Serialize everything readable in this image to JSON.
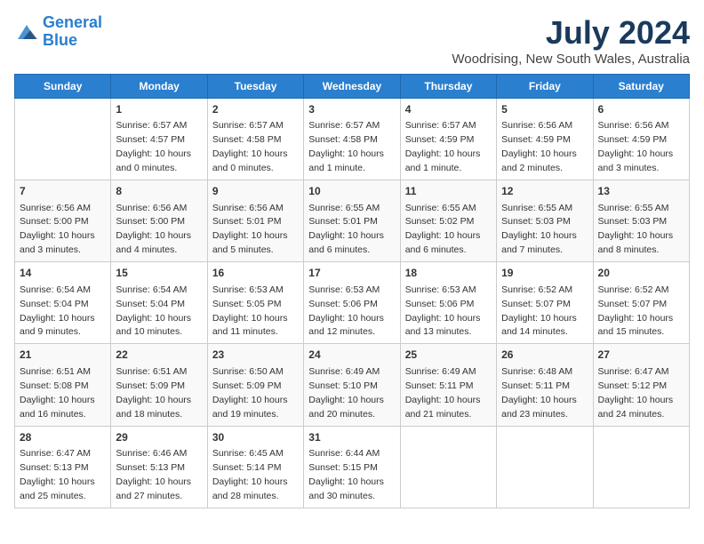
{
  "logo": {
    "line1": "General",
    "line2": "Blue"
  },
  "title": "July 2024",
  "location": "Woodrising, New South Wales, Australia",
  "days_header": [
    "Sunday",
    "Monday",
    "Tuesday",
    "Wednesday",
    "Thursday",
    "Friday",
    "Saturday"
  ],
  "weeks": [
    [
      {
        "num": "",
        "sunrise": "",
        "sunset": "",
        "daylight": ""
      },
      {
        "num": "1",
        "sunrise": "Sunrise: 6:57 AM",
        "sunset": "Sunset: 4:57 PM",
        "daylight": "Daylight: 10 hours and 0 minutes."
      },
      {
        "num": "2",
        "sunrise": "Sunrise: 6:57 AM",
        "sunset": "Sunset: 4:58 PM",
        "daylight": "Daylight: 10 hours and 0 minutes."
      },
      {
        "num": "3",
        "sunrise": "Sunrise: 6:57 AM",
        "sunset": "Sunset: 4:58 PM",
        "daylight": "Daylight: 10 hours and 1 minute."
      },
      {
        "num": "4",
        "sunrise": "Sunrise: 6:57 AM",
        "sunset": "Sunset: 4:59 PM",
        "daylight": "Daylight: 10 hours and 1 minute."
      },
      {
        "num": "5",
        "sunrise": "Sunrise: 6:56 AM",
        "sunset": "Sunset: 4:59 PM",
        "daylight": "Daylight: 10 hours and 2 minutes."
      },
      {
        "num": "6",
        "sunrise": "Sunrise: 6:56 AM",
        "sunset": "Sunset: 4:59 PM",
        "daylight": "Daylight: 10 hours and 3 minutes."
      }
    ],
    [
      {
        "num": "7",
        "sunrise": "Sunrise: 6:56 AM",
        "sunset": "Sunset: 5:00 PM",
        "daylight": "Daylight: 10 hours and 3 minutes."
      },
      {
        "num": "8",
        "sunrise": "Sunrise: 6:56 AM",
        "sunset": "Sunset: 5:00 PM",
        "daylight": "Daylight: 10 hours and 4 minutes."
      },
      {
        "num": "9",
        "sunrise": "Sunrise: 6:56 AM",
        "sunset": "Sunset: 5:01 PM",
        "daylight": "Daylight: 10 hours and 5 minutes."
      },
      {
        "num": "10",
        "sunrise": "Sunrise: 6:55 AM",
        "sunset": "Sunset: 5:01 PM",
        "daylight": "Daylight: 10 hours and 6 minutes."
      },
      {
        "num": "11",
        "sunrise": "Sunrise: 6:55 AM",
        "sunset": "Sunset: 5:02 PM",
        "daylight": "Daylight: 10 hours and 6 minutes."
      },
      {
        "num": "12",
        "sunrise": "Sunrise: 6:55 AM",
        "sunset": "Sunset: 5:03 PM",
        "daylight": "Daylight: 10 hours and 7 minutes."
      },
      {
        "num": "13",
        "sunrise": "Sunrise: 6:55 AM",
        "sunset": "Sunset: 5:03 PM",
        "daylight": "Daylight: 10 hours and 8 minutes."
      }
    ],
    [
      {
        "num": "14",
        "sunrise": "Sunrise: 6:54 AM",
        "sunset": "Sunset: 5:04 PM",
        "daylight": "Daylight: 10 hours and 9 minutes."
      },
      {
        "num": "15",
        "sunrise": "Sunrise: 6:54 AM",
        "sunset": "Sunset: 5:04 PM",
        "daylight": "Daylight: 10 hours and 10 minutes."
      },
      {
        "num": "16",
        "sunrise": "Sunrise: 6:53 AM",
        "sunset": "Sunset: 5:05 PM",
        "daylight": "Daylight: 10 hours and 11 minutes."
      },
      {
        "num": "17",
        "sunrise": "Sunrise: 6:53 AM",
        "sunset": "Sunset: 5:06 PM",
        "daylight": "Daylight: 10 hours and 12 minutes."
      },
      {
        "num": "18",
        "sunrise": "Sunrise: 6:53 AM",
        "sunset": "Sunset: 5:06 PM",
        "daylight": "Daylight: 10 hours and 13 minutes."
      },
      {
        "num": "19",
        "sunrise": "Sunrise: 6:52 AM",
        "sunset": "Sunset: 5:07 PM",
        "daylight": "Daylight: 10 hours and 14 minutes."
      },
      {
        "num": "20",
        "sunrise": "Sunrise: 6:52 AM",
        "sunset": "Sunset: 5:07 PM",
        "daylight": "Daylight: 10 hours and 15 minutes."
      }
    ],
    [
      {
        "num": "21",
        "sunrise": "Sunrise: 6:51 AM",
        "sunset": "Sunset: 5:08 PM",
        "daylight": "Daylight: 10 hours and 16 minutes."
      },
      {
        "num": "22",
        "sunrise": "Sunrise: 6:51 AM",
        "sunset": "Sunset: 5:09 PM",
        "daylight": "Daylight: 10 hours and 18 minutes."
      },
      {
        "num": "23",
        "sunrise": "Sunrise: 6:50 AM",
        "sunset": "Sunset: 5:09 PM",
        "daylight": "Daylight: 10 hours and 19 minutes."
      },
      {
        "num": "24",
        "sunrise": "Sunrise: 6:49 AM",
        "sunset": "Sunset: 5:10 PM",
        "daylight": "Daylight: 10 hours and 20 minutes."
      },
      {
        "num": "25",
        "sunrise": "Sunrise: 6:49 AM",
        "sunset": "Sunset: 5:11 PM",
        "daylight": "Daylight: 10 hours and 21 minutes."
      },
      {
        "num": "26",
        "sunrise": "Sunrise: 6:48 AM",
        "sunset": "Sunset: 5:11 PM",
        "daylight": "Daylight: 10 hours and 23 minutes."
      },
      {
        "num": "27",
        "sunrise": "Sunrise: 6:47 AM",
        "sunset": "Sunset: 5:12 PM",
        "daylight": "Daylight: 10 hours and 24 minutes."
      }
    ],
    [
      {
        "num": "28",
        "sunrise": "Sunrise: 6:47 AM",
        "sunset": "Sunset: 5:13 PM",
        "daylight": "Daylight: 10 hours and 25 minutes."
      },
      {
        "num": "29",
        "sunrise": "Sunrise: 6:46 AM",
        "sunset": "Sunset: 5:13 PM",
        "daylight": "Daylight: 10 hours and 27 minutes."
      },
      {
        "num": "30",
        "sunrise": "Sunrise: 6:45 AM",
        "sunset": "Sunset: 5:14 PM",
        "daylight": "Daylight: 10 hours and 28 minutes."
      },
      {
        "num": "31",
        "sunrise": "Sunrise: 6:44 AM",
        "sunset": "Sunset: 5:15 PM",
        "daylight": "Daylight: 10 hours and 30 minutes."
      },
      {
        "num": "",
        "sunrise": "",
        "sunset": "",
        "daylight": ""
      },
      {
        "num": "",
        "sunrise": "",
        "sunset": "",
        "daylight": ""
      },
      {
        "num": "",
        "sunrise": "",
        "sunset": "",
        "daylight": ""
      }
    ]
  ]
}
